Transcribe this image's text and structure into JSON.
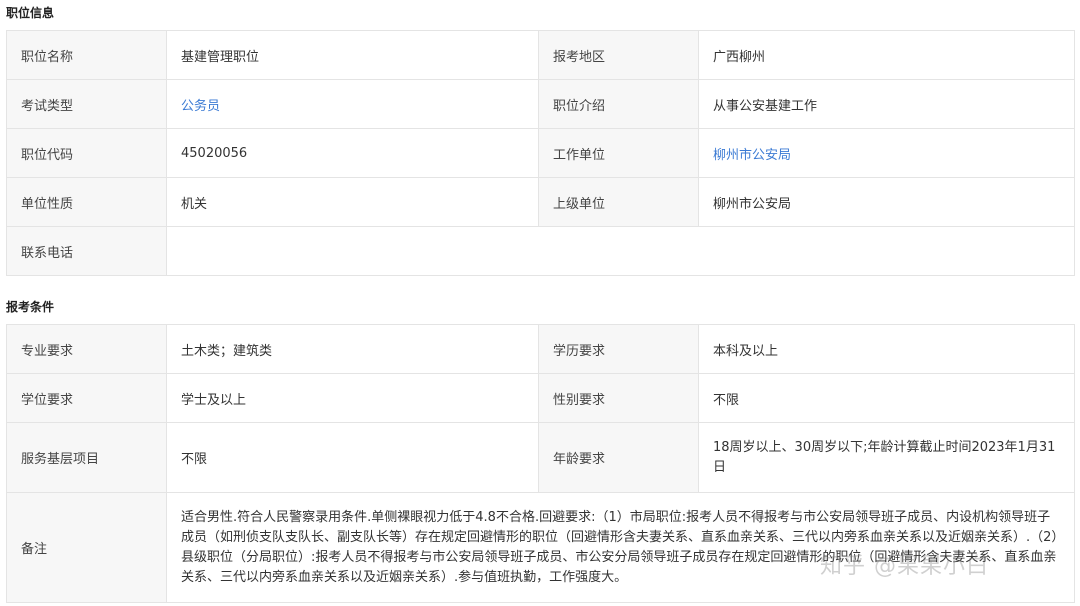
{
  "sections": {
    "position_info": "职位信息",
    "requirements": "报考条件"
  },
  "position": {
    "name_label": "职位名称",
    "name_value": "基建管理职位",
    "region_label": "报考地区",
    "region_value": "广西柳州",
    "exam_type_label": "考试类型",
    "exam_type_value": "公务员",
    "intro_label": "职位介绍",
    "intro_value": "从事公安基建工作",
    "code_label": "职位代码",
    "code_value": "45020056",
    "unit_label": "工作单位",
    "unit_value": "柳州市公安局",
    "nature_label": "单位性质",
    "nature_value": "机关",
    "superior_label": "上级单位",
    "superior_value": "柳州市公安局",
    "phone_label": "联系电话",
    "phone_value": ""
  },
  "requirements": {
    "major_label": "专业要求",
    "major_value": "土木类；建筑类",
    "education_label": "学历要求",
    "education_value": "本科及以上",
    "degree_label": "学位要求",
    "degree_value": "学士及以上",
    "gender_label": "性别要求",
    "gender_value": "不限",
    "service_label": "服务基层项目",
    "service_value": "不限",
    "age_label": "年龄要求",
    "age_value": "18周岁以上、30周岁以下;年龄计算截止时间2023年1月31日",
    "notes_label": "备注",
    "notes_value": "适合男性.符合人民警察录用条件.单侧裸眼视力低于4.8不合格.回避要求:（1）市局职位:报考人员不得报考与市公安局领导班子成员、内设机构领导班子成员（如刑侦支队支队长、副支队长等）存在规定回避情形的职位（回避情形含夫妻关系、直系血亲关系、三代以内旁系血亲关系以及近姻亲关系）.（2）县级职位（分局职位）:报考人员不得报考与市公安局领导班子成员、市公安分局领导班子成员存在规定回避情形的职位（回避情形含夫妻关系、直系血亲关系、三代以内旁系血亲关系以及近姻亲关系）.参与值班执勤，工作强度大。"
  },
  "watermark": "知乎 @果果小白"
}
